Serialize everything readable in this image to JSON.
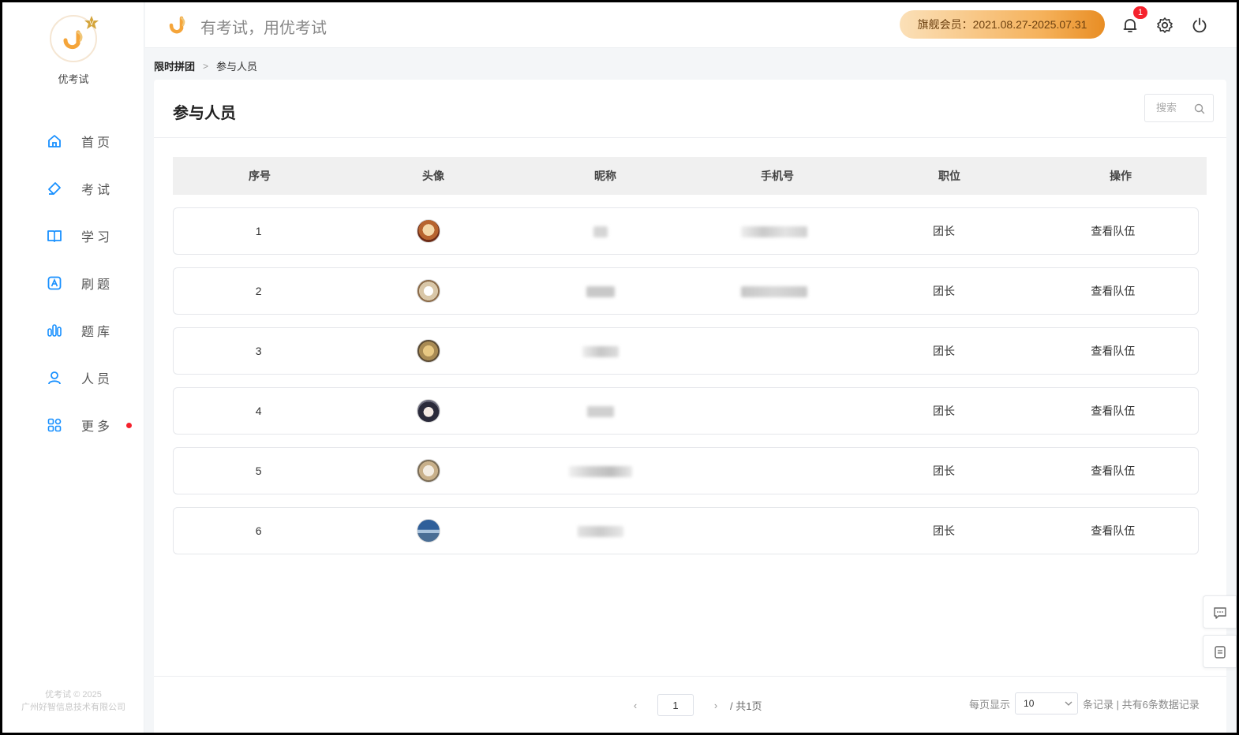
{
  "brand": {
    "name": "优考试",
    "slogan": "有考试，用优考试"
  },
  "sidebar": {
    "items": [
      {
        "label": "首页",
        "icon": "home-icon"
      },
      {
        "label": "考试",
        "icon": "eraser-icon"
      },
      {
        "label": "学习",
        "icon": "book-icon"
      },
      {
        "label": "刷题",
        "icon": "letter-a-icon"
      },
      {
        "label": "题库",
        "icon": "bars-icon"
      },
      {
        "label": "人员",
        "icon": "user-icon"
      },
      {
        "label": "更多",
        "icon": "grid-icon"
      }
    ],
    "copyright_line1": "优考试 © 2025",
    "copyright_line2": "广州好智信息技术有限公司"
  },
  "header": {
    "membership": "旗舰会员：2021.08.27-2025.07.31",
    "notification_count": "1"
  },
  "breadcrumb": {
    "parent": "限时拼团",
    "current": "参与人员"
  },
  "page": {
    "title": "参与人员",
    "search_placeholder": "搜索"
  },
  "table": {
    "columns": [
      "序号",
      "头像",
      "昵称",
      "手机号",
      "职位",
      "操作"
    ],
    "rows": [
      {
        "index": "1",
        "role": "团长",
        "action": "查看队伍"
      },
      {
        "index": "2",
        "role": "团长",
        "action": "查看队伍"
      },
      {
        "index": "3",
        "role": "团长",
        "action": "查看队伍"
      },
      {
        "index": "4",
        "role": "团长",
        "action": "查看队伍"
      },
      {
        "index": "5",
        "role": "团长",
        "action": "查看队伍"
      },
      {
        "index": "6",
        "role": "团长",
        "action": "查看队伍"
      }
    ]
  },
  "pagination": {
    "prev": "‹",
    "next": "›",
    "current_page": "1",
    "total_pages": "/ 共1页",
    "per_page_label": "每页显示",
    "per_page_value": "10",
    "records_label": "条记录 | 共有6条数据记录"
  },
  "colors": {
    "accent": "#1890ff",
    "member_gradient_end": "#e88d24",
    "alert": "#f5222d"
  }
}
